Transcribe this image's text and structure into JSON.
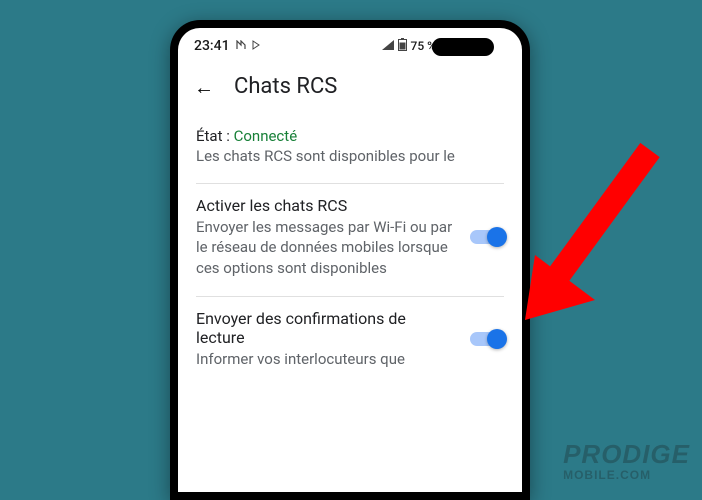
{
  "status_bar": {
    "time": "23:41",
    "battery_text": "75 %"
  },
  "header": {
    "back_glyph": "←",
    "title": "Chats RCS"
  },
  "status_section": {
    "label": "État :",
    "value": "Connecté",
    "description": "Les chats RCS sont disponibles pour le"
  },
  "settings": [
    {
      "title": "Activer les chats RCS",
      "description": "Envoyer les messages par Wi-Fi ou par le réseau de données mobiles lorsque ces options sont disponibles",
      "on": true
    },
    {
      "title": "Envoyer des confirmations de lecture",
      "description": "Informer vos interlocuteurs que",
      "on": true
    }
  ],
  "watermark": {
    "line1": "PRODIGE",
    "line2": "MOBILE.COM"
  }
}
